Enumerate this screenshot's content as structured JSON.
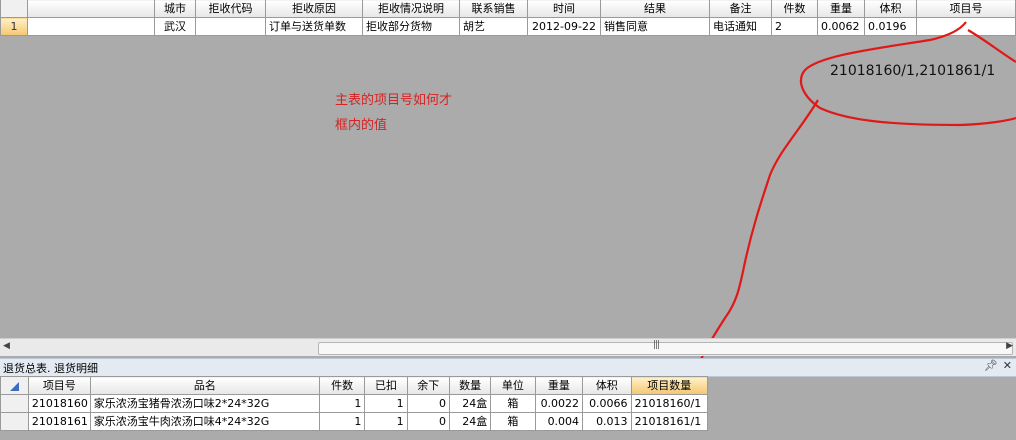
{
  "top_grid": {
    "headers": [
      "城市",
      "拒收代码",
      "拒收原因",
      "拒收情况说明",
      "联系销售",
      "时间",
      "结果",
      "备注",
      "件数",
      "重量",
      "体积",
      "项目号"
    ],
    "row_number": "1",
    "row": [
      "武汉",
      "",
      "订单与送货单数",
      "拒收部分货物",
      "胡艺",
      "2012-09-22",
      "销售同意",
      "电话通知",
      "2",
      "0.0062",
      "0.0196",
      ""
    ]
  },
  "annotation": {
    "line1": "主表的项目号如何才",
    "line2": "框内的值"
  },
  "callout_value": "21018160/1,2101861/1",
  "scrollbar": {
    "left_arrow": "◀",
    "right_arrow": "▶",
    "grip": "|||"
  },
  "panel": {
    "title": "退货总表. 退货明细",
    "pin_icon": "pin-icon",
    "close_icon": "close-icon"
  },
  "bottom_grid": {
    "headers": [
      "项目号",
      "品名",
      "件数",
      "已扣",
      "余下",
      "数量",
      "单位",
      "重量",
      "体积",
      "项目数量"
    ],
    "rows": [
      [
        "21018160",
        "家乐浓汤宝猪骨浓汤口味2*24*32G",
        "1",
        "1",
        "0",
        "24盒",
        "箱",
        "0.0022",
        "0.0066",
        "21018160/1"
      ],
      [
        "21018161",
        "家乐浓汤宝牛肉浓汤口味4*24*32G",
        "1",
        "1",
        "0",
        "24盒",
        "箱",
        "0.004",
        "0.013",
        "21018161/1"
      ]
    ]
  },
  "colors": {
    "annotation": "#d82222",
    "background": "#ababab",
    "selected_header": "#f4c772"
  }
}
